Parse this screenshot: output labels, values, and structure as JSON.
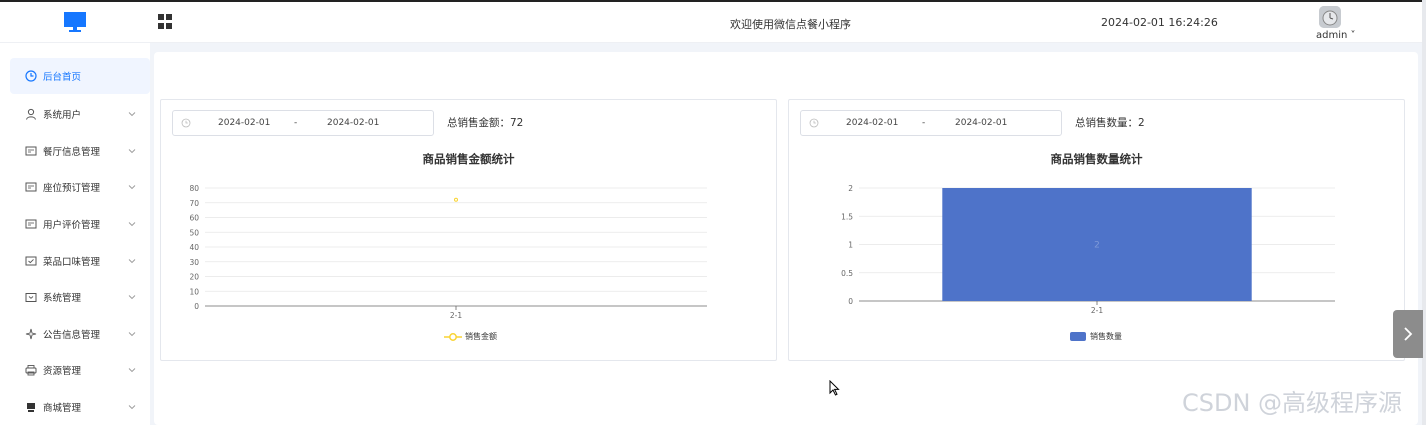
{
  "header": {
    "welcome": "欢迎使用微信点餐小程序",
    "datetime": "2024-02-01 16:24:26",
    "user": "admin ˅"
  },
  "sidebar": {
    "items": [
      {
        "label": "后台首页",
        "icon": "clock-icon",
        "active": true
      },
      {
        "label": "系统用户",
        "icon": "user-icon"
      },
      {
        "label": "餐厅信息管理",
        "icon": "card-icon"
      },
      {
        "label": "座位预订管理",
        "icon": "card-icon"
      },
      {
        "label": "用户评价管理",
        "icon": "card-icon"
      },
      {
        "label": "菜品口味管理",
        "icon": "check-card-icon"
      },
      {
        "label": "系统管理",
        "icon": "folder-icon"
      },
      {
        "label": "公告信息管理",
        "icon": "sparkle-icon"
      },
      {
        "label": "资源管理",
        "icon": "print-icon"
      },
      {
        "label": "商城管理",
        "icon": "store-icon"
      }
    ]
  },
  "sales_amount": {
    "start_date": "2024-02-01",
    "separator": "-",
    "end_date": "2024-02-01",
    "total_label": "总销售金额：72",
    "title": "商品销售金额统计",
    "legend": "销售金额"
  },
  "sales_count": {
    "start_date": "2024-02-01",
    "separator": "-",
    "end_date": "2024-02-01",
    "total_label": "总销售数量：2",
    "title": "商品销售数量统计",
    "legend": "销售数量"
  },
  "chart_data": [
    {
      "type": "line",
      "title": "商品销售金额统计",
      "categories": [
        "2-1"
      ],
      "series": [
        {
          "name": "销售金额",
          "values": [
            72
          ]
        }
      ],
      "ylim": [
        0,
        80
      ],
      "yticks": [
        "0",
        "10",
        "20",
        "30",
        "40",
        "50",
        "60",
        "70",
        "80"
      ],
      "grid": true,
      "legend_position": "bottom",
      "color": "#f9d433"
    },
    {
      "type": "bar",
      "title": "商品销售数量统计",
      "categories": [
        "2-1"
      ],
      "series": [
        {
          "name": "销售数量",
          "values": [
            2
          ]
        }
      ],
      "ylim": [
        0,
        2
      ],
      "yticks": [
        "0",
        "0.5",
        "1",
        "1.5",
        "2"
      ],
      "grid": true,
      "legend_position": "bottom",
      "color": "#4e73c9",
      "value_label": "2"
    }
  ],
  "watermark": "CSDN @高级程序源"
}
